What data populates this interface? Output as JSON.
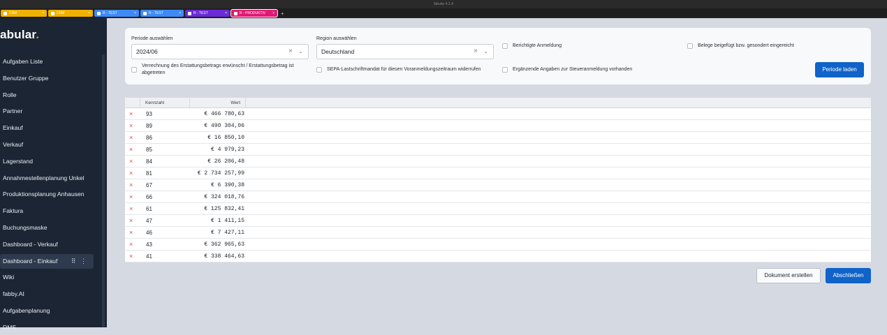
{
  "window_title": "fabular 4.1.4",
  "tabs": [
    {
      "label": "CRM",
      "color": "#f1b100"
    },
    {
      "label": "CRM",
      "color": "#f1b100"
    },
    {
      "label": "R - TEST",
      "color": "#3d8af7"
    },
    {
      "label": "R - TEST",
      "color": "#3d8af7"
    },
    {
      "label": "R - TEST",
      "color": "#6b2bd6"
    },
    {
      "label": "R - PRODUKTIV",
      "color": "#e01a74"
    }
  ],
  "tab_add": "+",
  "logo": {
    "text": "abular",
    "dot": "."
  },
  "sidebar": {
    "items": [
      {
        "label": "Aufgaben Liste"
      },
      {
        "label": "Benutzer Gruppe"
      },
      {
        "label": "Rolle"
      },
      {
        "label": "Partner"
      },
      {
        "label": "Einkauf"
      },
      {
        "label": "Verkauf"
      },
      {
        "label": "Lagerstand"
      },
      {
        "label": "Annahmestellenplanung Unkel"
      },
      {
        "label": "Produktionsplanung Anhausen"
      },
      {
        "label": "Faktura"
      },
      {
        "label": "Buchungsmaske"
      },
      {
        "label": "Dashboard - Verkauf"
      },
      {
        "label": "Dashboard - Einkauf",
        "active": true
      },
      {
        "label": "Wiki"
      },
      {
        "label": "fabby.AI"
      },
      {
        "label": "Aufgabenplanung"
      },
      {
        "label": "DMS"
      }
    ],
    "active_actions": "⠿ ⋮"
  },
  "form": {
    "period_label": "Periode auswählen",
    "period_value": "2024/06",
    "region_label": "Region auswählen",
    "region_value": "Deutschland",
    "clear_icon": "×",
    "chevron_icon": "⌄",
    "cb_berichtigte": "Berichtigte Anmeldung",
    "cb_belege": "Belege beigefügt bzw. gesondert eingereicht",
    "cb_verrechnung_1": "Verrechnung des Erstattungsbetrags erwünscht / Erstattungsbetrag ist",
    "cb_verrechnung_2": "abgetreten",
    "cb_sepa": "SEPA-Lastschriftmandat für diesen Voranmeldungszeitraum widerrufen",
    "cb_ergaenzende": "Ergänzende Angaben zur Steueranmeldung vorhanden",
    "load_button": "Periode laden"
  },
  "table": {
    "col_kennzahl": "Kennzahl",
    "col_wert": "Wert",
    "delete_icon": "×",
    "rows": [
      {
        "k": "93",
        "v": "€ 466 780,63"
      },
      {
        "k": "89",
        "v": "€ 490 304,06"
      },
      {
        "k": "86",
        "v": "€ 16 850,10"
      },
      {
        "k": "85",
        "v": "€ 4 979,23"
      },
      {
        "k": "84",
        "v": "€ 26 206,48"
      },
      {
        "k": "81",
        "v": "€ 2 734 257,99"
      },
      {
        "k": "67",
        "v": "€ 6 390,38"
      },
      {
        "k": "66",
        "v": "€ 324 018,76"
      },
      {
        "k": "61",
        "v": "€ 125 832,41"
      },
      {
        "k": "47",
        "v": "€ 1 411,15"
      },
      {
        "k": "46",
        "v": "€ 7 427,11"
      },
      {
        "k": "43",
        "v": "€ 362 965,63"
      },
      {
        "k": "41",
        "v": "€ 338 464,63"
      }
    ]
  },
  "actions": {
    "create_doc": "Dokument erstellen",
    "finish": "Abschließen"
  }
}
